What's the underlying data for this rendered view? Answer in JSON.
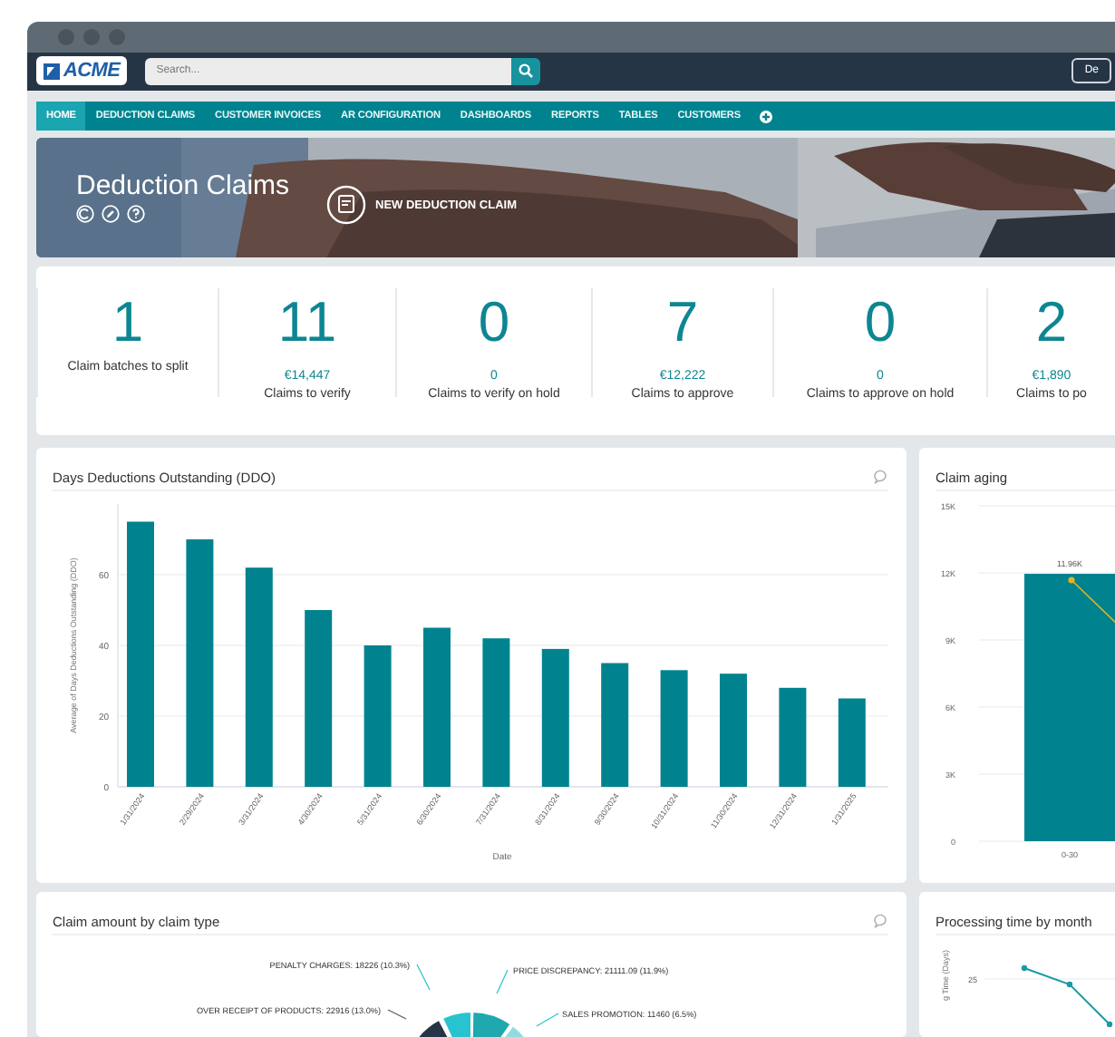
{
  "topbar": {
    "logo": "ACME",
    "search": {
      "placeholder": "Search..."
    },
    "user_button": "De"
  },
  "menu": [
    {
      "label": "HOME",
      "selected": true
    },
    {
      "label": "DEDUCTION CLAIMS",
      "selected": false
    },
    {
      "label": "CUSTOMER INVOICES",
      "selected": false
    },
    {
      "label": "AR CONFIGURATION",
      "selected": false
    },
    {
      "label": "DASHBOARDS",
      "selected": false
    },
    {
      "label": "REPORTS",
      "selected": false
    },
    {
      "label": "TABLES",
      "selected": false
    },
    {
      "label": "CUSTOMERS",
      "selected": false
    }
  ],
  "hero": {
    "title": "Deduction Claims",
    "action": "NEW DEDUCTION CLAIM"
  },
  "kpis": [
    {
      "value": "1",
      "label": "Claim batches to split"
    },
    {
      "value": "11",
      "amount": "€14,447",
      "label": "Claims to verify"
    },
    {
      "value": "0",
      "amount": "0",
      "label": "Claims to verify on hold"
    },
    {
      "value": "7",
      "amount": "€12,222",
      "label": "Claims to approve"
    },
    {
      "value": "0",
      "amount": "0",
      "label": "Claims to approve on hold"
    },
    {
      "value": "2",
      "amount": "€1,890",
      "label": "Claims to po"
    }
  ],
  "ddo_chart": {
    "title": "Days Deductions Outstanding (DDO)",
    "chart_data": {
      "type": "bar",
      "xlabel": "Date",
      "ylabel": "Average of Days Deductions Outstanding (DDO)",
      "categories": [
        "1/31/2024",
        "2/29/2024",
        "3/31/2024",
        "4/30/2024",
        "5/31/2024",
        "6/30/2024",
        "7/31/2024",
        "8/31/2024",
        "9/30/2024",
        "10/31/2024",
        "11/30/2024",
        "12/31/2024",
        "1/31/2025"
      ],
      "values": [
        75,
        70,
        62,
        50,
        40,
        45,
        42,
        39,
        35,
        33,
        32,
        28,
        25
      ],
      "yticks": [
        0,
        20,
        40,
        60
      ],
      "ylim": [
        0,
        80
      ],
      "grid": true
    }
  },
  "aging_chart": {
    "title": "Claim aging",
    "chart_data": {
      "type": "bar",
      "categories": [
        "0-30"
      ],
      "values": [
        11960
      ],
      "ylim": [
        0,
        15000
      ],
      "grid": true,
      "yticks": [
        {
          "value": 0,
          "label": "0"
        },
        {
          "value": 3000,
          "label": "3K"
        },
        {
          "value": 6000,
          "label": "6K"
        },
        {
          "value": 9000,
          "label": "9K"
        },
        {
          "value": 12000,
          "label": "12K"
        },
        {
          "value": 15000,
          "label": "15K"
        }
      ],
      "value_labels": [
        "11.96K"
      ]
    }
  },
  "claim_type_chart": {
    "title": "Claim amount by claim type",
    "labels": [
      "PENALTY CHARGES: 18226 (10.3%)",
      "PRICE DISCREPANCY: 21111.09 (11.9%)",
      "OVER RECEIPT OF PRODUCTS: 22916 (13.0%)",
      "SALES PROMOTION: 11460 (6.5%)"
    ]
  },
  "processing_chart": {
    "title": "Processing time by month",
    "axis_label": "g Time (Days)",
    "tick": "25"
  }
}
